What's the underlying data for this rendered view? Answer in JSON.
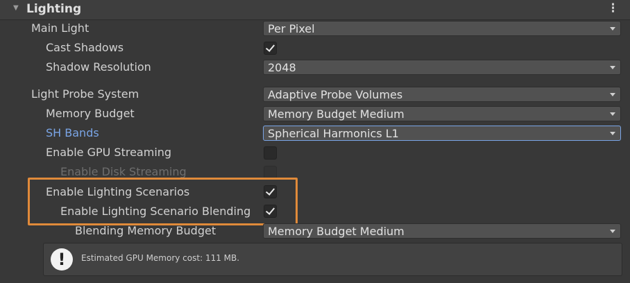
{
  "header": {
    "title": "Lighting",
    "fold_icon": "triangle-down-icon",
    "menu_icon": "kebab-icon"
  },
  "rows": {
    "main_light": {
      "label": "Main Light",
      "value": "Per Pixel"
    },
    "cast_shadows": {
      "label": "Cast Shadows",
      "checked": true
    },
    "shadow_resolution": {
      "label": "Shadow Resolution",
      "value": "2048"
    },
    "light_probe_system": {
      "label": "Light Probe System",
      "value": "Adaptive Probe Volumes"
    },
    "memory_budget": {
      "label": "Memory Budget",
      "value": "Memory Budget Medium"
    },
    "sh_bands": {
      "label": "SH Bands",
      "value": "Spherical Harmonics L1"
    },
    "enable_gpu_streaming": {
      "label": "Enable GPU Streaming",
      "checked": false
    },
    "enable_disk_streaming": {
      "label": "Enable Disk Streaming",
      "checked": false
    },
    "enable_lighting_scenarios": {
      "label": "Enable Lighting Scenarios",
      "checked": true
    },
    "enable_lighting_scenario_blending": {
      "label": "Enable Lighting Scenario Blending",
      "checked": true
    },
    "blending_memory_budget": {
      "label": "Blending Memory Budget",
      "value": "Memory Budget Medium"
    }
  },
  "info": {
    "icon": "warning-icon",
    "text": "Estimated GPU Memory cost: 111 MB."
  },
  "colors": {
    "highlight": "#e08a3a",
    "accent_label": "#7aa5e6",
    "background": "#383838"
  }
}
